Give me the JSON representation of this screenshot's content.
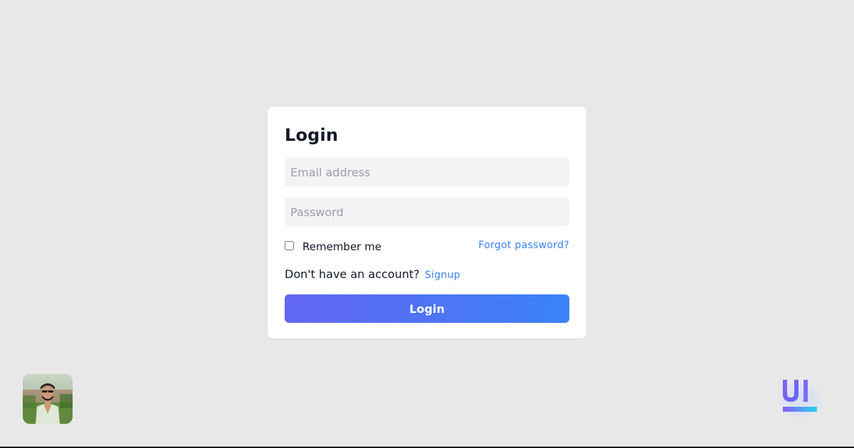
{
  "login_form": {
    "title": "Login",
    "email_placeholder": "Email address",
    "password_placeholder": "Password",
    "remember_label": "Remember me",
    "remember_checked": false,
    "forgot_link": "Forgot password?",
    "signup_prompt": "Don't have an account?",
    "signup_link": "Signup",
    "submit_label": "Login"
  },
  "colors": {
    "background": "#e8e8e8",
    "card": "#ffffff",
    "input_background": "#f2f3f5",
    "link": "#3b82f6",
    "button_gradient_start": "#6366f1",
    "button_gradient_end": "#3b82f6"
  },
  "icons": {
    "avatar": "user-avatar-photo",
    "brand": "ui-brand-logo"
  }
}
